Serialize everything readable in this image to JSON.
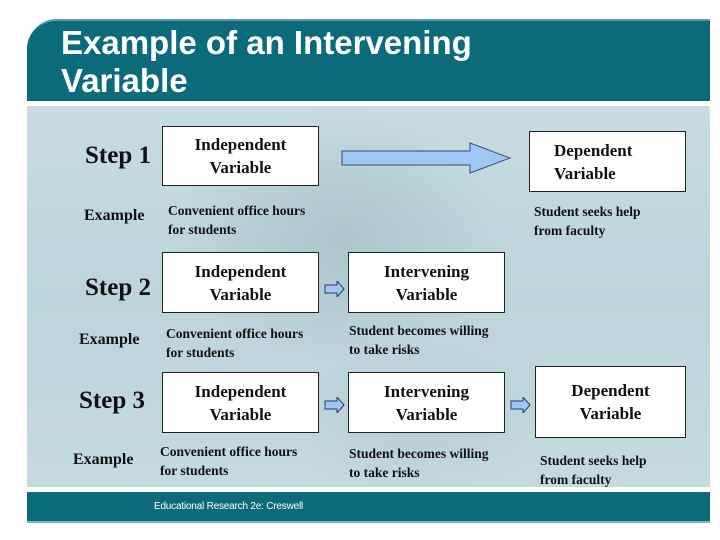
{
  "header": {
    "title_line1": "Example of an Intervening",
    "title_line2": "Variable"
  },
  "footer": {
    "text": "Educational Research 2e:  Creswell"
  },
  "colors": {
    "header_bg": "#0b6b7b",
    "panel_bg": "#c6dce0",
    "arrow_fill": "#9fc7f5"
  },
  "steps": [
    {
      "label": "Step 1",
      "example_label": "Example",
      "boxes": [
        {
          "line1": "Independent",
          "line2": "Variable",
          "desc1": "Convenient office hours",
          "desc2": "for students"
        },
        {
          "line1": "Dependent",
          "line2": "Variable",
          "desc1": "Student seeks help",
          "desc2": "from faculty"
        }
      ],
      "arrow_icon": "large-right-arrow"
    },
    {
      "label": "Step 2",
      "example_label": "Example",
      "boxes": [
        {
          "line1": "Independent",
          "line2": "Variable",
          "desc1": "Convenient office hours",
          "desc2": "for students"
        },
        {
          "line1": "Intervening",
          "line2": "Variable",
          "desc1": "Student becomes willing",
          "desc2": "to take risks"
        }
      ]
    },
    {
      "label": "Step 3",
      "example_label": "Example",
      "boxes": [
        {
          "line1": "Independent",
          "line2": "Variable",
          "desc1": "Convenient office hours",
          "desc2": "for students"
        },
        {
          "line1": "Intervening",
          "line2": "Variable",
          "desc1": "Student becomes willing",
          "desc2": "to take risks"
        },
        {
          "line1": "Dependent",
          "line2": "Variable",
          "desc1": "Student seeks help",
          "desc2": "from faculty"
        }
      ]
    }
  ]
}
